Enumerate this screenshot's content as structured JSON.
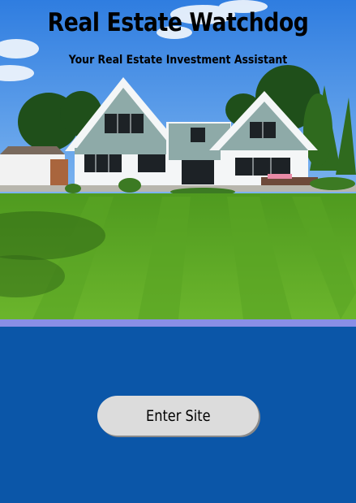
{
  "header": {
    "title": "Real Estate Watchdog",
    "subtitle": "Your Real Estate Investment Assistant"
  },
  "hero": {
    "image": "house-with-lawn-photo"
  },
  "actions": {
    "enter_label": "Enter Site"
  },
  "colors": {
    "divider": "#8a8fe6",
    "panel": "#0b56a8",
    "button": "#dcdcdc"
  }
}
